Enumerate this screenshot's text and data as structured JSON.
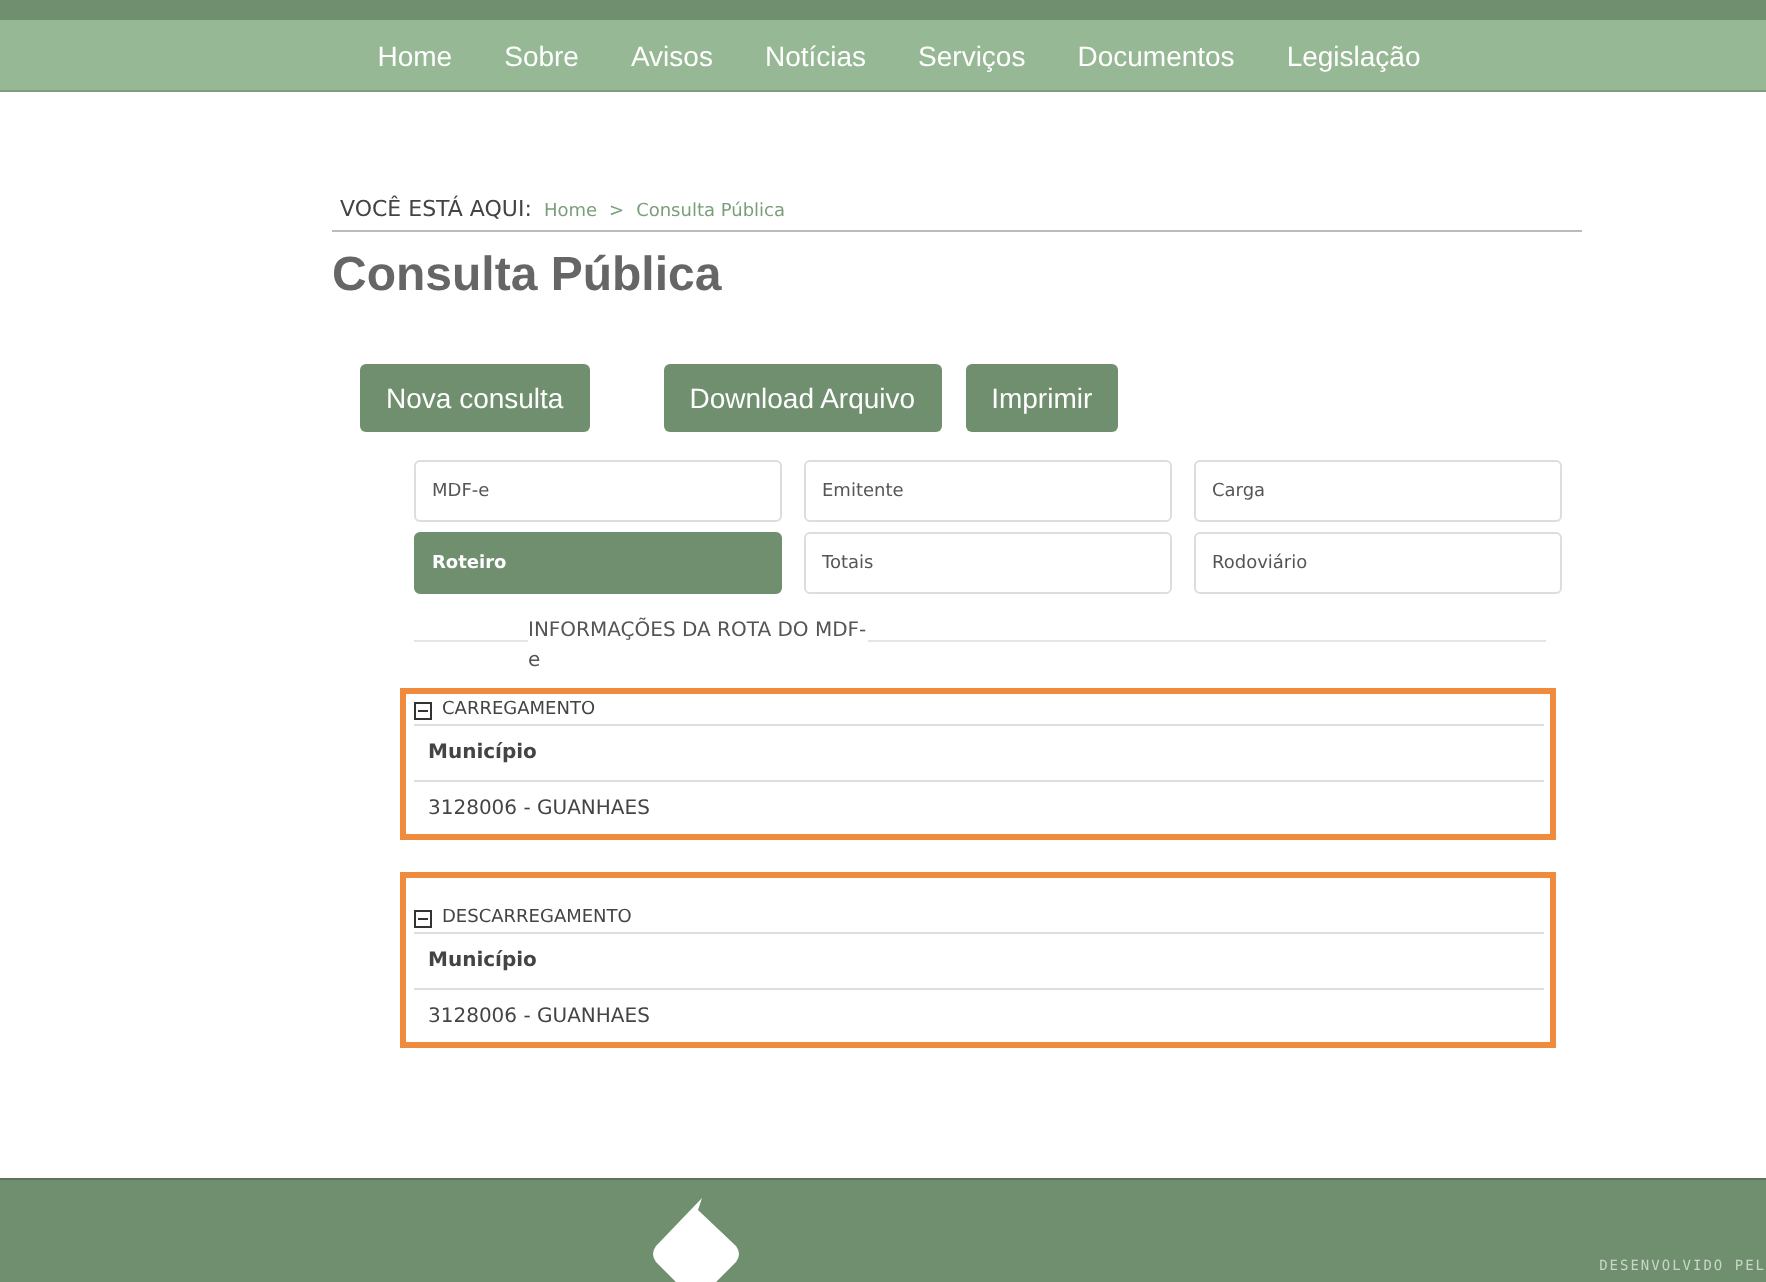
{
  "nav": {
    "items": [
      "Home",
      "Sobre",
      "Avisos",
      "Notícias",
      "Serviços",
      "Documentos",
      "Legislação"
    ]
  },
  "breadcrumb": {
    "label": "VOCÊ ESTÁ AQUI:",
    "items": [
      "Home",
      "Consulta Pública"
    ],
    "separator": ">"
  },
  "page_title": "Consulta Pública",
  "buttons": [
    "Nova consulta",
    "Download Arquivo",
    "Imprimir"
  ],
  "tabs": [
    {
      "label": "MDF-e",
      "selected": false
    },
    {
      "label": "Emitente",
      "selected": false
    },
    {
      "label": "Carga",
      "selected": false
    },
    {
      "label": "Roteiro",
      "selected": true
    },
    {
      "label": "Totais",
      "selected": false
    },
    {
      "label": "Rodoviário",
      "selected": false
    }
  ],
  "section_title": "INFORMAÇÕES DA ROTA DO MDF-e",
  "groups": [
    {
      "title": "CARREGAMENTO",
      "expanded": true,
      "field_label": "Município",
      "field_value": "3128006 - GUANHAES"
    },
    {
      "title": "DESCARREGAMENTO",
      "expanded": true,
      "field_label": "Município",
      "field_value": "3128006 - GUANHAES"
    }
  ],
  "footer": {
    "credit": "DESENVOLVIDO PEL"
  }
}
